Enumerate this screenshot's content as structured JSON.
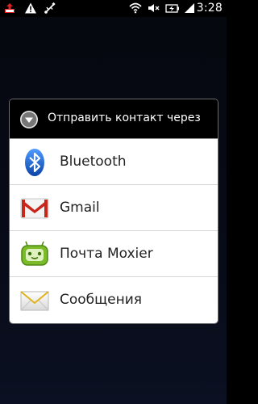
{
  "status_bar": {
    "time": "3:28",
    "icons": [
      "upload-notification-icon",
      "warning-icon",
      "usb-icon",
      "wifi-icon",
      "mute-icon",
      "battery-charging-icon",
      "signal-icon"
    ]
  },
  "dialog": {
    "title": "Отправить контакт через",
    "title_icon": "chevron-down-circle-icon",
    "items": [
      {
        "label": "Bluetooth",
        "icon": "bluetooth-icon"
      },
      {
        "label": "Gmail",
        "icon": "gmail-icon"
      },
      {
        "label": "Почта Moxier",
        "icon": "moxier-mail-icon"
      },
      {
        "label": "Сообщения",
        "icon": "messages-envelope-icon"
      }
    ]
  },
  "colors": {
    "background": "#060a16",
    "header_bg": "#000000",
    "list_bg": "#ffffff",
    "bluetooth": "#1e6ad1",
    "gmail_red": "#c8261b",
    "moxier_green": "#7bbb2a"
  }
}
